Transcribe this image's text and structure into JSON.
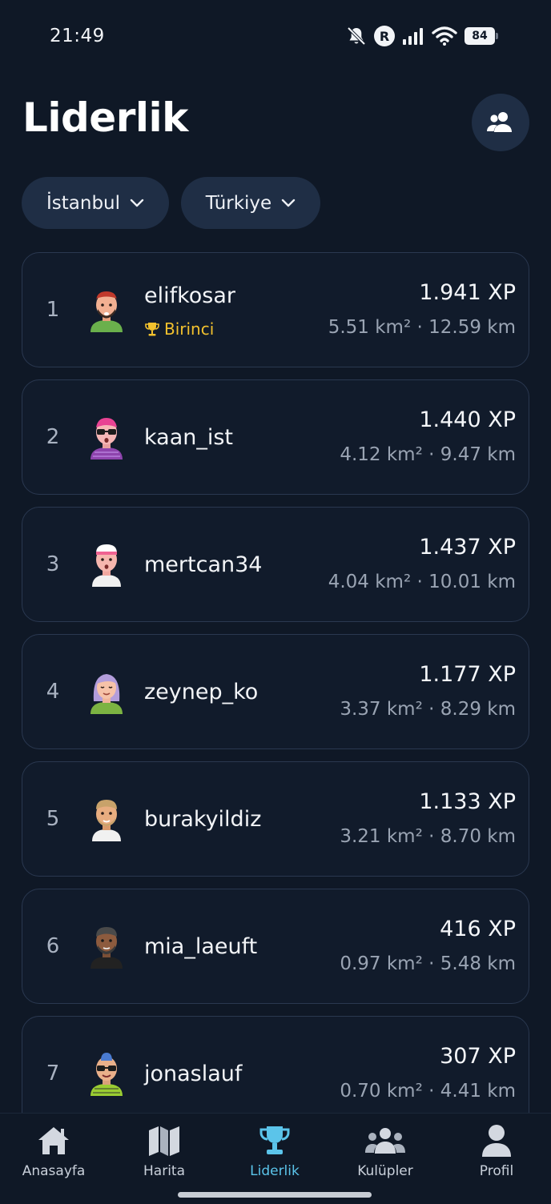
{
  "status_bar": {
    "time": "21:49",
    "battery": "84",
    "network_badge": "R"
  },
  "header": {
    "title": "Liderlik",
    "friends_icon": "people-icon"
  },
  "filters": {
    "city": "İstanbul",
    "country": "Türkiye"
  },
  "leaderboard": [
    {
      "rank": "1",
      "username": "elifkosar",
      "badge": "Birinci",
      "xp": "1.941 XP",
      "stats": "5.51 km² · 12.59 km"
    },
    {
      "rank": "2",
      "username": "kaan_ist",
      "xp": "1.440 XP",
      "stats": "4.12 km² · 9.47 km"
    },
    {
      "rank": "3",
      "username": "mertcan34",
      "xp": "1.437 XP",
      "stats": "4.04 km² · 10.01 km"
    },
    {
      "rank": "4",
      "username": "zeynep_ko",
      "xp": "1.177 XP",
      "stats": "3.37 km² · 8.29 km"
    },
    {
      "rank": "5",
      "username": "burakyildiz",
      "xp": "1.133 XP",
      "stats": "3.21 km² · 8.70 km"
    },
    {
      "rank": "6",
      "username": "mia_laeuft",
      "xp": "416 XP",
      "stats": "0.97 km² · 5.48 km"
    },
    {
      "rank": "7",
      "username": "jonaslauf",
      "xp": "307 XP",
      "stats": "0.70 km² · 4.41 km"
    }
  ],
  "nav": [
    {
      "label": "Anasayfa",
      "icon": "home-icon",
      "active": false
    },
    {
      "label": "Harita",
      "icon": "map-icon",
      "active": false
    },
    {
      "label": "Liderlik",
      "icon": "trophy-icon",
      "active": true
    },
    {
      "label": "Kulüpler",
      "icon": "clubs-icon",
      "active": false
    },
    {
      "label": "Profil",
      "icon": "profile-icon",
      "active": false
    }
  ],
  "colors": {
    "background": "#0f1826",
    "card": "#111b2b",
    "card_border": "#2a3850",
    "chip": "#1f2e45",
    "accent": "#5bc4ea",
    "gold": "#f2c12e"
  }
}
